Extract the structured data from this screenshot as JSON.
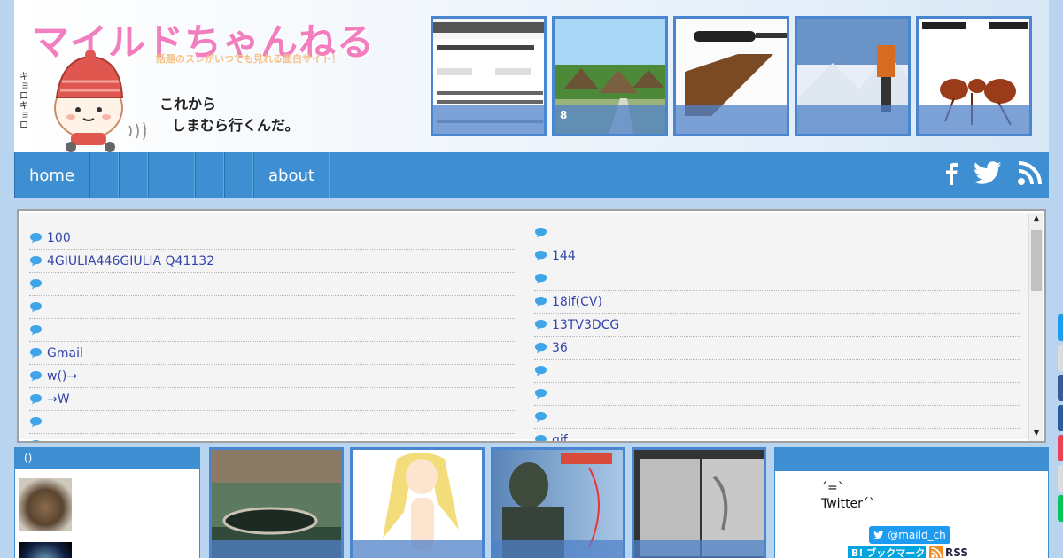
{
  "header": {
    "site_title": "マイルドちゃんねる",
    "tagline": "話題のスレがいつでも見れる面白サイト！",
    "mascot_line1": "これから",
    "mascot_line2": "しまむら行くんだ。",
    "mascot_sfx": "キョロキョロ",
    "thumbnails": [
      {
        "name": "news",
        "caption": ""
      },
      {
        "name": "village",
        "caption": "8"
      },
      {
        "name": "rifle",
        "caption": ""
      },
      {
        "name": "mountain",
        "caption": ""
      },
      {
        "name": "ant",
        "caption": ""
      }
    ]
  },
  "nav": {
    "home": "home",
    "about": "about",
    "social": [
      "facebook-icon",
      "twitter-icon",
      "rss-icon"
    ]
  },
  "feed": {
    "left": [
      "100",
      "4GIULIA446GIULIA Q41132",
      "",
      "",
      "",
      "Gmail",
      "w()→",
      "→W",
      "",
      ""
    ],
    "right": [
      "",
      "144",
      "",
      "18if(CV)",
      "13TV3DCG",
      "36",
      "",
      "",
      "",
      "gif"
    ]
  },
  "widget_left": {
    "title": "()"
  },
  "widget_right": {
    "line1": "´=`",
    "line2": "Twitter´`",
    "twitter_handle": "@maild_ch",
    "hatena_label": "B! ブックマーク",
    "rss_label": "RSS"
  },
  "colors": {
    "nav": "#3e8fd2",
    "accent": "#4a86cf",
    "title_pink": "#f27ec0",
    "link": "#3344aa"
  }
}
